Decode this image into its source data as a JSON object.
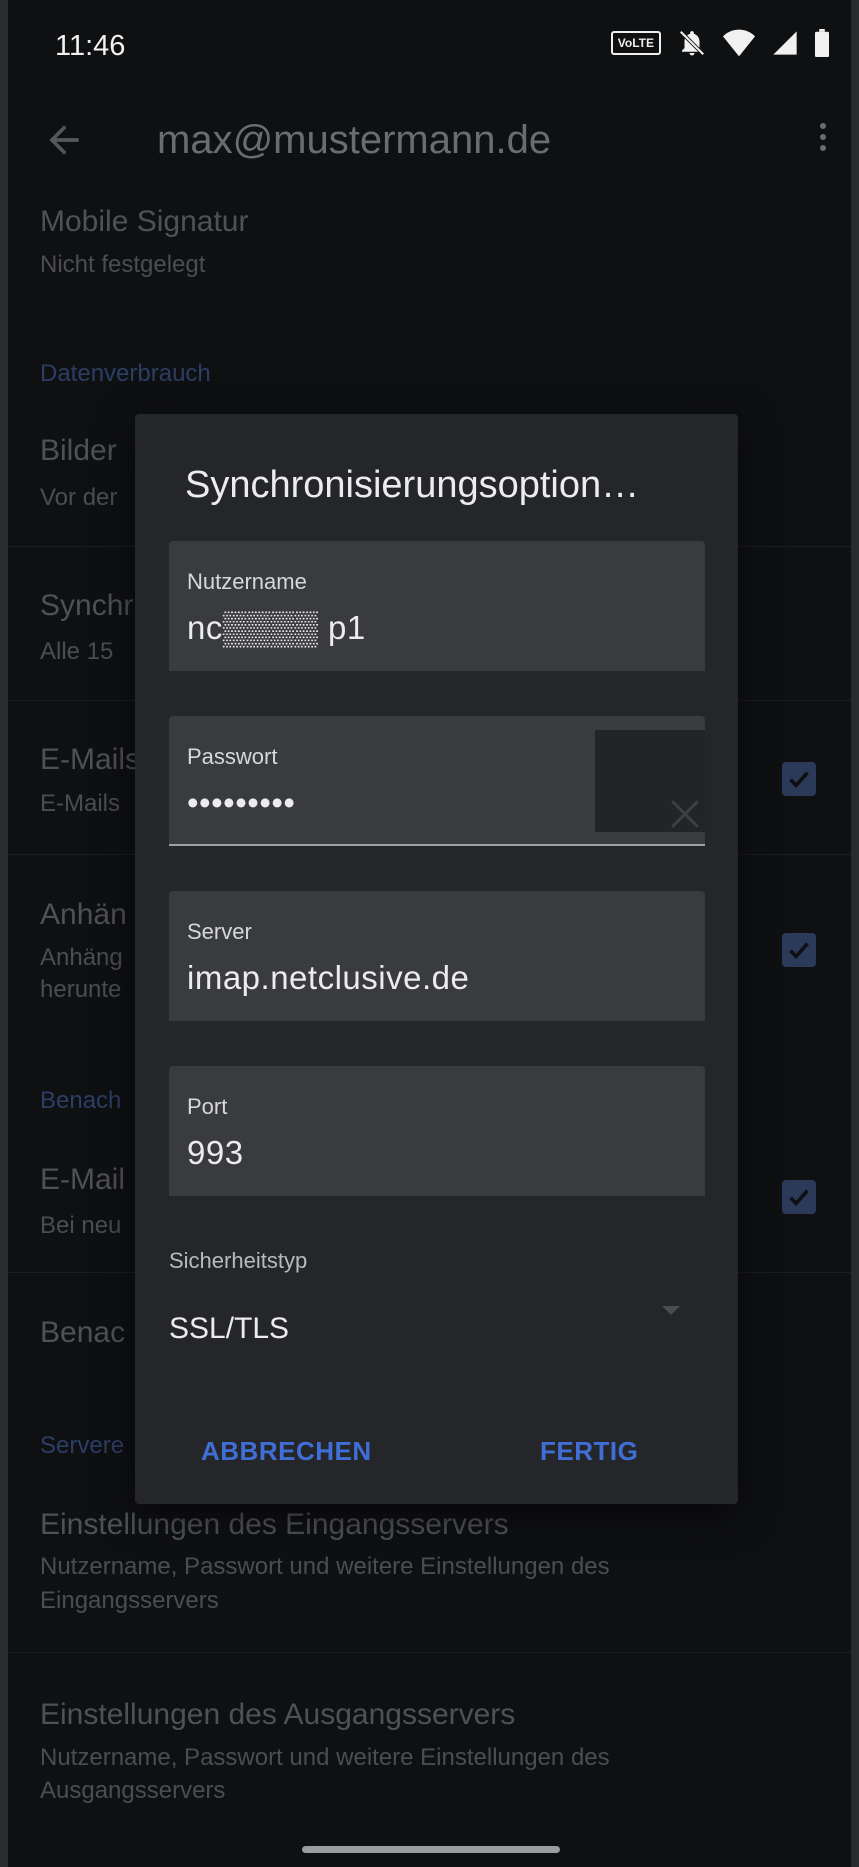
{
  "status_bar": {
    "time": "11:46",
    "volte_label": "VoLTE",
    "icons": [
      "volte-icon",
      "bell-off-icon",
      "wifi-icon",
      "signal-icon",
      "battery-icon"
    ]
  },
  "app_bar": {
    "title": "max@mustermann.de",
    "back_icon": "arrow-left-icon",
    "more_icon": "more-vert-icon"
  },
  "background_settings": {
    "mobile_signature": {
      "title": "Mobile Signatur",
      "subtitle": "Nicht festgelegt"
    },
    "section_data": "Datenverbrauch",
    "images": {
      "title": "Bilder",
      "subtitle": "Vor der"
    },
    "sync": {
      "title": "Synchr",
      "subtitle": "Alle 15"
    },
    "emails": {
      "title": "E-Mails",
      "subtitle": "E-Mails",
      "checked": true
    },
    "attachments": {
      "title": "Anhän",
      "subtitle_line1": "Anhäng",
      "subtitle_line2": "herunte",
      "checked": true
    },
    "section_notifications": "Benach",
    "email_notify": {
      "title": "E-Mail",
      "subtitle": "Bei neu",
      "checked": true
    },
    "notify_item": {
      "title": "Benac"
    },
    "section_server": "Servere",
    "incoming": {
      "title": "Einstellungen des Eingangsservers",
      "subtitle_line1": "Nutzername, Passwort und weitere Einstellungen des",
      "subtitle_line2": "Eingangsservers"
    },
    "outgoing": {
      "title": "Einstellungen des Ausgangsservers",
      "subtitle_line1": "Nutzername, Passwort und weitere Einstellungen des",
      "subtitle_line2": "Ausgangsservers"
    }
  },
  "dialog": {
    "title": "Synchronisierungsoption…",
    "username": {
      "label": "Nutzername",
      "value": "nc▒▒▒▒ p1"
    },
    "password": {
      "label": "Passwort",
      "value": "•••••••••"
    },
    "server": {
      "label": "Server",
      "value": "imap.netclusive.de"
    },
    "port": {
      "label": "Port",
      "value": "993"
    },
    "security": {
      "label": "Sicherheitstyp",
      "value": "SSL/TLS"
    },
    "cancel_label": "ABBRECHEN",
    "done_label": "FERTIG"
  },
  "colors": {
    "accent": "#3f6fd6",
    "dialog_bg": "#25262a",
    "field_bg": "#3a3b3f",
    "screen_bg": "#0f1012"
  }
}
